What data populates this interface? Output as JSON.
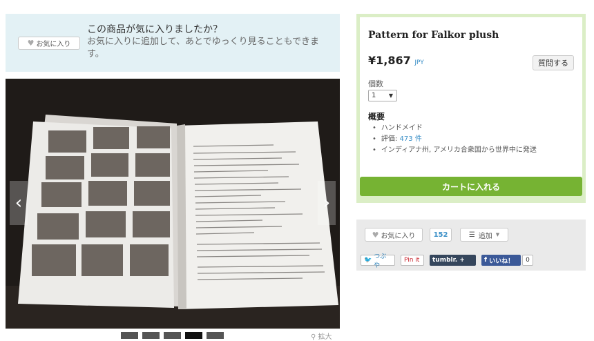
{
  "favorite_banner": {
    "button_label": "お気に入り",
    "question": "この商品が気に入りましたか？",
    "subtext": "お気に入りに追加して、あとでゆっくり見ることもできます。"
  },
  "gallery": {
    "prev_icon": "‹",
    "next_icon": "›",
    "zoom_label": "拡大",
    "thumbnails": [
      "thumb-1",
      "thumb-2",
      "thumb-3",
      "thumb-4",
      "thumb-5"
    ],
    "selected_thumbnail": 4
  },
  "listing": {
    "title": "Pattern for Falkor plush",
    "price": "¥1,867",
    "currency": "JPY",
    "ask_button": "質問する",
    "quantity_label": "個数",
    "quantity_value": "1",
    "overview_heading": "概要",
    "features": {
      "handmade": "ハンドメイド",
      "rating_label": "評価: ",
      "rating_link": "473 件",
      "shipping": "インディアナ州, アメリカ合衆国から世界中に発送"
    },
    "cart_button": "カートに入れる"
  },
  "actions": {
    "favorite_label": "お気に入り",
    "favorite_count": "152",
    "add_label": "追加",
    "social": {
      "twitter": "つぶや",
      "pinterest": "Pin it",
      "tumblr": "tumblr. +",
      "facebook": "いいね！",
      "facebook_count": "0"
    }
  },
  "colors": {
    "banner_bg": "#e3f1f5",
    "card_border": "#dbeec6",
    "cart_green": "#76b333",
    "link_blue": "#3a8fc7"
  }
}
